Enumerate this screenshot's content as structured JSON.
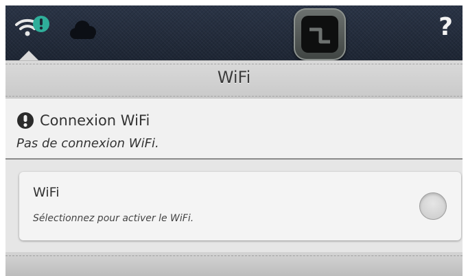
{
  "top_bar": {
    "wifi_status_icon": "wifi-alert-icon",
    "cloud_icon": "cloud-icon",
    "logo_icon": "app-logo-icon",
    "help_label": "?"
  },
  "header": {
    "title": "WiFi"
  },
  "status": {
    "icon": "exclamation-icon",
    "title": "Connexion WiFi",
    "message": "Pas de connexion WiFi."
  },
  "wifi_card": {
    "title": "WiFi",
    "description": "Sélectionnez pour activer le WiFi.",
    "enabled": false
  },
  "colors": {
    "top_bar": "#1f2736",
    "alert_teal": "#2fae9a",
    "header_band": "#d2d2d2",
    "status_bg": "#f1f1f1",
    "card_bg": "#f4f4f4"
  }
}
